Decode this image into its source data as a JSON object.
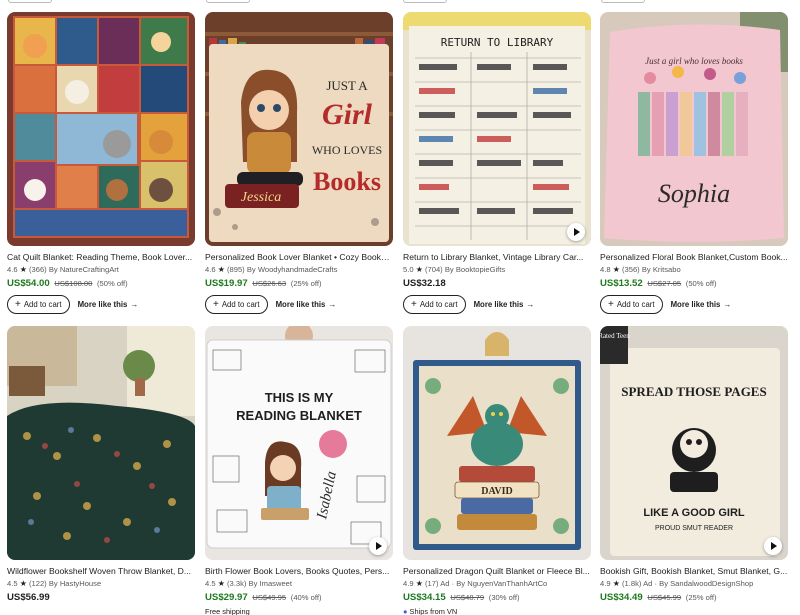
{
  "actions": {
    "add_to_cart": "Add to cart",
    "more_like_this": "More like this",
    "arrow": "→"
  },
  "listings": [
    {
      "title": "Cat Quilt Blanket: Reading Theme, Book Lover...",
      "rating": "4.6",
      "reviews": "(366)",
      "by": "By NatureCraftingArt",
      "price": "US$54.00",
      "original_price": "US$108.00",
      "discount": "(50% off)",
      "sale": true,
      "video": false
    },
    {
      "title": "Personalized Book Lover Blanket • Cozy Bookw...",
      "rating": "4.6",
      "reviews": "(895)",
      "by": "By WoodyhandmadeCrafts",
      "price": "US$19.97",
      "original_price": "US$26.63",
      "discount": "(25% off)",
      "sale": true,
      "video": false,
      "art_text": {
        "line1": "JUST A",
        "line2": "Girl",
        "line3": "WHO LOVES",
        "line4": "Books",
        "name": "Jessica"
      }
    },
    {
      "title": "Return to Library Blanket, Vintage Library Car...",
      "rating": "5.0",
      "reviews": "(704)",
      "by": "By BooktopieGifts",
      "price": "US$32.18",
      "original_price": "",
      "discount": "",
      "sale": false,
      "video": true,
      "art_text": {
        "heading": "RETURN TO LIBRARY"
      }
    },
    {
      "title": "Personalized Floral Book Blanket,Custom Book...",
      "rating": "4.8",
      "reviews": "(356)",
      "by": "By Kritsabo",
      "price": "US$13.52",
      "original_price": "US$27.05",
      "discount": "(50% off)",
      "sale": true,
      "video": false,
      "art_text": {
        "tag": "Just a girl who loves books",
        "name": "Sophia"
      }
    },
    {
      "title": "Wildflower Bookshelf Woven Throw Blanket, D...",
      "rating": "4.5",
      "reviews": "(122)",
      "by": "By HastyHouse",
      "price": "US$56.99",
      "original_price": "",
      "discount": "",
      "sale": false,
      "video": false
    },
    {
      "title": "Birth Flower Book Lovers, Books Quotes, Pers...",
      "rating": "4.5",
      "reviews": "(3.3k)",
      "by": "By Imasweet",
      "price": "US$29.97",
      "original_price": "US$49.95",
      "discount": "(40% off)",
      "sale": true,
      "video": true,
      "extra": "Free shipping",
      "art_text": {
        "line1": "THIS IS MY",
        "line2": "READING BLANKET",
        "name": "Isabella"
      }
    },
    {
      "title": "Personalized Dragon Quilt Blanket or Fleece Bl...",
      "rating": "4.9",
      "reviews": "(17)",
      "by": "Ad · By NguyenVanThanhArtCo",
      "price": "US$34.15",
      "original_price": "US$48.79",
      "discount": "(30% off)",
      "sale": true,
      "video": false,
      "extra": "Ships from VN",
      "art_text": {
        "name": "DAVID"
      }
    },
    {
      "title": "Bookish Gift, Bookish Blanket, Smut Blanket, G...",
      "rating": "4.9",
      "reviews": "(1.8k)",
      "by": "Ad · By SandalwoodDesignShop",
      "price": "US$34.49",
      "original_price": "US$45.99",
      "discount": "(25% off)",
      "sale": true,
      "video": true,
      "art_text": {
        "line1": "SPREAD THOSE PAGES",
        "line2": "LIKE A GOOD GIRL",
        "line3": "PROUD SMUT READER",
        "badge": "Rated Teen"
      }
    }
  ]
}
